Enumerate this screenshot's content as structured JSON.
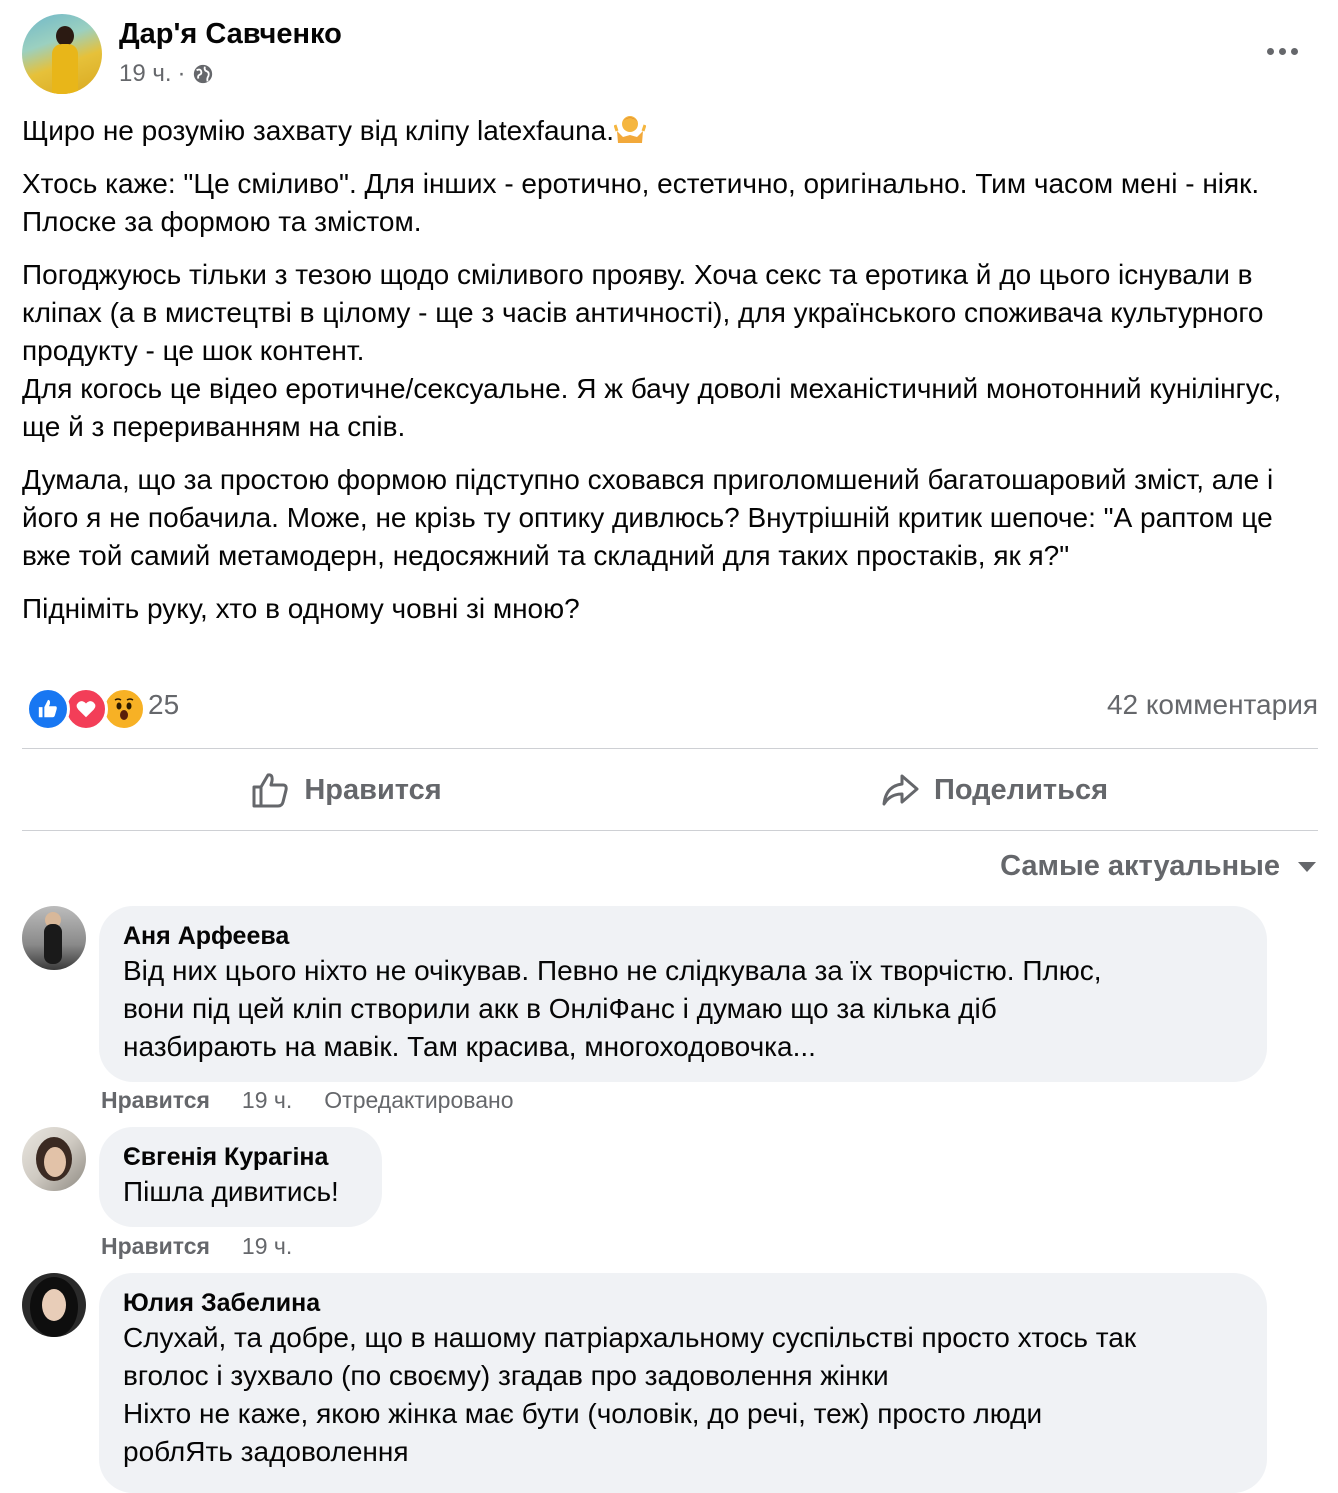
{
  "post": {
    "author": "Дар'я Савченко",
    "time": "19 ч.",
    "separator": "·",
    "paragraphs": [
      "Щиро не розумію захвату від кліпу latexfauna.",
      "Хтось каже: \"Це сміливо\". Для інших - еротично, естетично, оригінально. Тим часом мені - ніяк. Плоске за формою та змістом.",
      "Погоджуюсь тільки з тезою щодо сміливого прояву. Хоча секс та еротика й до цього існували в кліпах (а в мистецтві в цілому - ще з часів античності), для українського споживача культурного продукту - це шок контент.",
      "Для когось це відео еротичне/сексуальне. Я ж бачу доволі механістичний монотонний кунілінгус, ще й з перериванням на спів.",
      "Думала, що за простою формою підступно сховався приголомшений багатошаровий зміст, але і його я не побачила. Може, не крізь ту оптику дивлюсь? Внутрішній критик шепоче: \"А раптом це вже той самий метамодерн, недосяжний та складний для таких простаків, як я?\"",
      "Підніміть руку, хто в одному човні зі мною?"
    ],
    "emoji": "shrug-emoji-icon",
    "reactions_count": "25",
    "reactions": [
      "like-icon",
      "love-icon",
      "wow-icon"
    ],
    "comments_count": "42 комментария"
  },
  "actions": {
    "like_label": "Нравится",
    "share_label": "Поделиться"
  },
  "sort": {
    "label": "Самые актуальные"
  },
  "comments": [
    {
      "name": "Аня Арфеева",
      "text_lines": [
        "Від них цього ніхто не очікував. Певно не слідкувала за їх творчістю. Плюс,",
        "вони під цей кліп створили акк в ОнліФанс і думаю що за кілька діб",
        "назбирають на мавік. Там красива, многоходовочка..."
      ],
      "like": "Нравится",
      "time": "19 ч.",
      "edited": "Отредактировано"
    },
    {
      "name": "Євгенія Курагіна",
      "text_lines": [
        "Пішла дивитись!"
      ],
      "like": "Нравится",
      "time": "19 ч."
    },
    {
      "name": "Юлия Забелина",
      "text_lines": [
        "Слухай, та добре, що в нашому патріархальному суспільстві просто хтось так",
        "вголос і зухвало (по своєму) згадав про задоволення жінки",
        "Ніхто не каже, якою жінка має бути (чоловік, до речі, теж) просто люди",
        "роблЯть задоволення"
      ]
    }
  ],
  "colors": {
    "text": "#050505",
    "secondary": "#65676b",
    "bubble": "#f0f2f5",
    "like_blue": "#1877f2",
    "love_red": "#f33e58",
    "wow_yellow": "#f7b125"
  }
}
